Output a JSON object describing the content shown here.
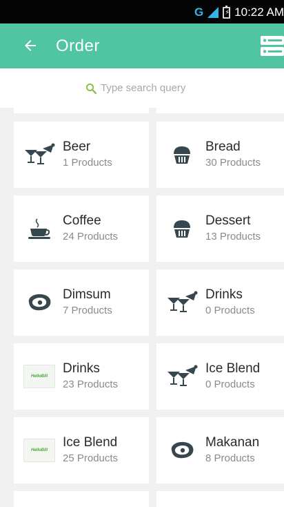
{
  "status_bar": {
    "network": "G",
    "time": "10:22 AM"
  },
  "app_bar": {
    "title": "Order",
    "back_icon": "arrow-left-icon",
    "menu_icon": "server-list-icon"
  },
  "search": {
    "placeholder": "Type search query"
  },
  "categories": [
    {
      "name": "Beer",
      "count": "1 Products",
      "icon": "cocktail-glasses-icon"
    },
    {
      "name": "Bread",
      "count": "30 Products",
      "icon": "cupcake-icon"
    },
    {
      "name": "Coffee",
      "count": "24 Products",
      "icon": "coffee-cup-icon"
    },
    {
      "name": "Dessert",
      "count": "13 Products",
      "icon": "cupcake-icon"
    },
    {
      "name": "Dimsum",
      "count": "7 Products",
      "icon": "steak-icon"
    },
    {
      "name": "Drinks",
      "count": "0 Products",
      "icon": "cocktail-glasses-icon"
    },
    {
      "name": "Drinks",
      "count": "23 Products",
      "icon": "hellobill-logo"
    },
    {
      "name": "Ice Blend",
      "count": "0 Products",
      "icon": "cocktail-glasses-icon"
    },
    {
      "name": "Ice Blend",
      "count": "25 Products",
      "icon": "hellobill-logo"
    },
    {
      "name": "Makanan",
      "count": "8 Products",
      "icon": "steak-icon"
    }
  ],
  "logo_text": "HelloBill",
  "colors": {
    "accent": "#51c4a2",
    "icon": "#37474f",
    "search_icon": "#8bc34a"
  }
}
